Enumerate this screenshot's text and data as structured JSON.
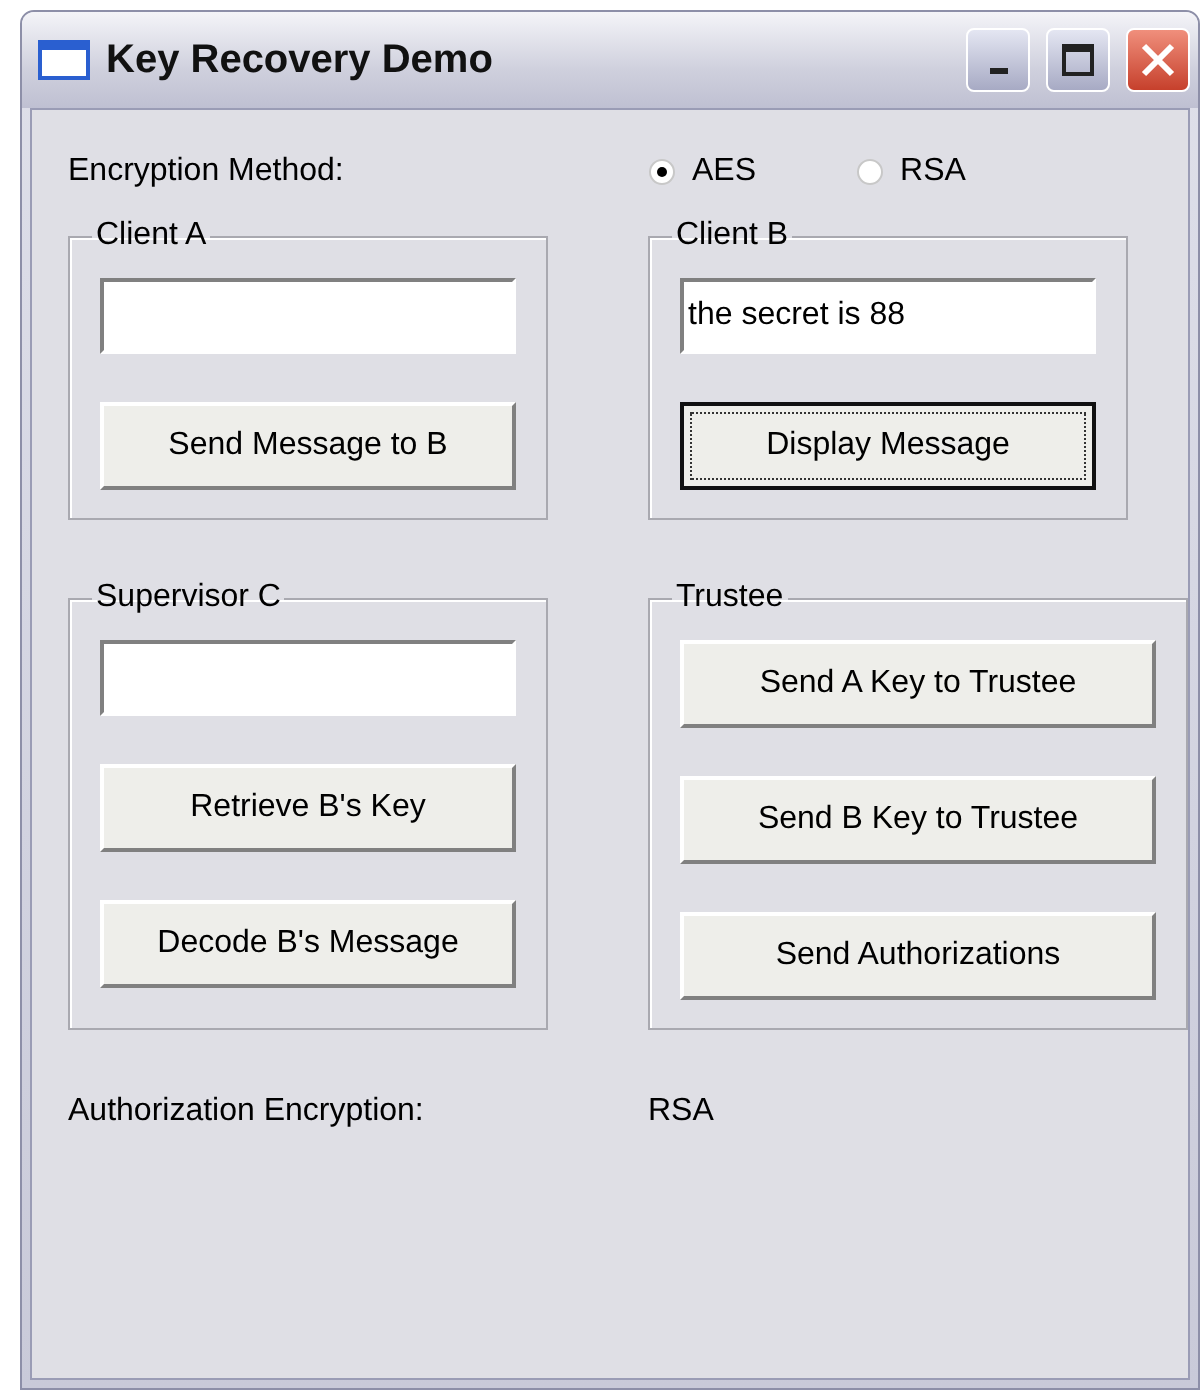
{
  "window": {
    "title": "Key Recovery Demo"
  },
  "encryption_method": {
    "label": "Encryption Method:",
    "options": [
      {
        "label": "AES",
        "selected": true
      },
      {
        "label": "RSA",
        "selected": false
      }
    ]
  },
  "groups": [
    {
      "title": "Client A",
      "controls": [
        {
          "kind": "field"
        },
        {
          "kind": "button",
          "label": "Send Message to B",
          "focused": false
        }
      ]
    },
    {
      "title": "Client B",
      "controls": [
        {
          "kind": "field",
          "value": "the secret is 88"
        },
        {
          "kind": "button",
          "label": "Display Message",
          "focused": true
        }
      ]
    },
    {
      "title": "Supervisor C",
      "controls": [
        {
          "kind": "field"
        },
        {
          "kind": "button",
          "label": "Retrieve B's Key",
          "focused": false
        },
        {
          "kind": "button",
          "label": "Decode B's Message",
          "focused": false
        }
      ]
    },
    {
      "title": "Trustee",
      "controls": [
        {
          "kind": "button",
          "label": "Send A Key to Trustee",
          "focused": false
        },
        {
          "kind": "button",
          "label": "Send B Key to Trustee",
          "focused": false
        },
        {
          "kind": "button",
          "label": "Send Authorizations",
          "focused": false
        }
      ]
    }
  ],
  "authorization_encryption": {
    "label": "Authorization Encryption:",
    "value": "RSA"
  }
}
